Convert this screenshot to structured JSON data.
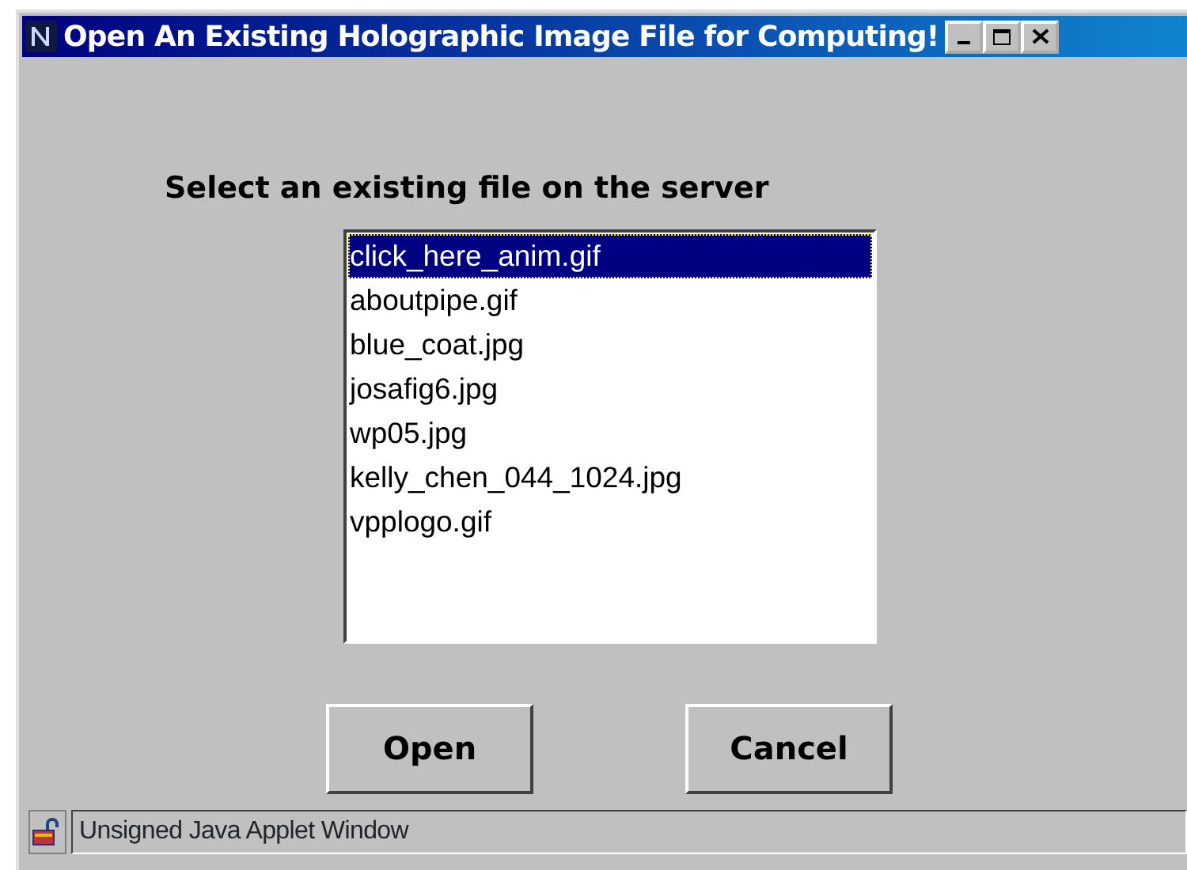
{
  "window": {
    "title": "Open An Existing Holographic Image File for Computing!"
  },
  "heading": "Select an existing file on the server",
  "files": [
    {
      "name": "click_here_anim.gif",
      "selected": true
    },
    {
      "name": "aboutpipe.gif",
      "selected": false
    },
    {
      "name": "blue_coat.jpg",
      "selected": false
    },
    {
      "name": "josafig6.jpg",
      "selected": false
    },
    {
      "name": "wp05.jpg",
      "selected": false
    },
    {
      "name": "kelly_chen_044_1024.jpg",
      "selected": false
    },
    {
      "name": "vpplogo.gif",
      "selected": false
    }
  ],
  "buttons": [
    "Open",
    "Cancel"
  ],
  "status_bar": "Unsigned Java Applet Window"
}
